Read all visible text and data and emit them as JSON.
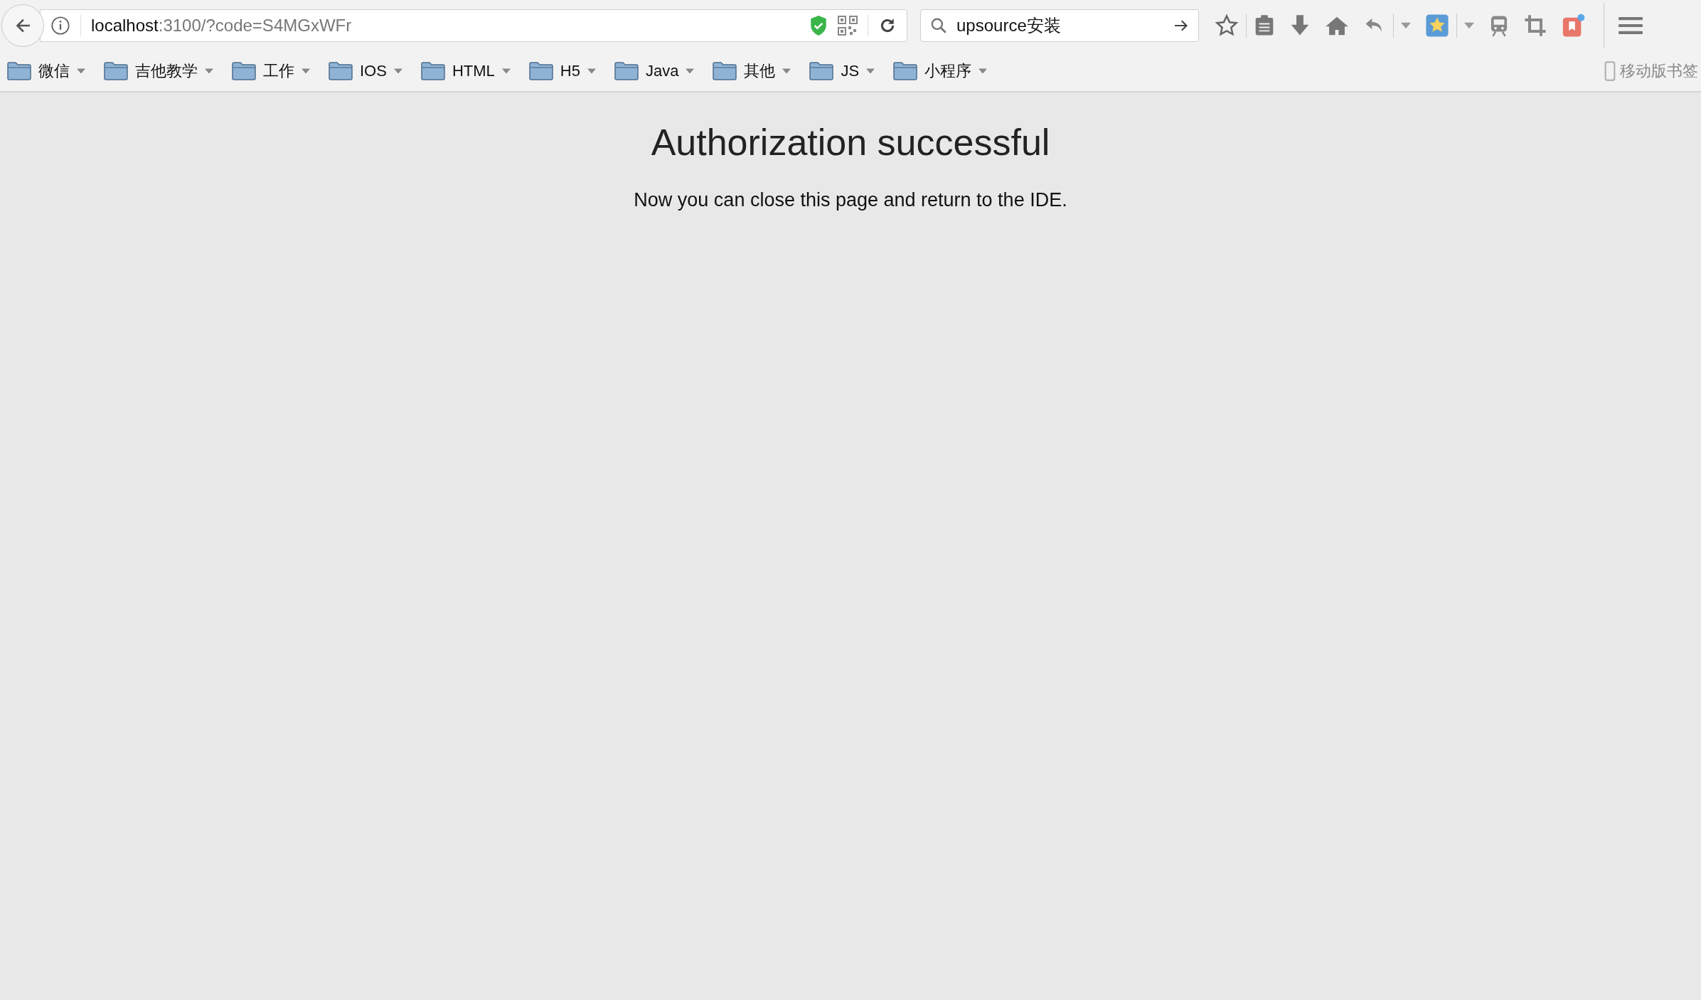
{
  "address_bar": {
    "host": "localhost",
    "path": ":3100/?code=S4MGxWFr"
  },
  "search": {
    "value": "upsource安装"
  },
  "bookmarks": [
    {
      "label": "微信"
    },
    {
      "label": "吉他教学"
    },
    {
      "label": "工作"
    },
    {
      "label": "IOS"
    },
    {
      "label": "HTML"
    },
    {
      "label": "H5"
    },
    {
      "label": "Java"
    },
    {
      "label": "其他"
    },
    {
      "label": "JS"
    },
    {
      "label": "小程序"
    }
  ],
  "mobile_bookmarks": {
    "label": "移动版书签"
  },
  "page": {
    "title": "Authorization successful",
    "message": "Now you can close this page and return to the IDE."
  }
}
